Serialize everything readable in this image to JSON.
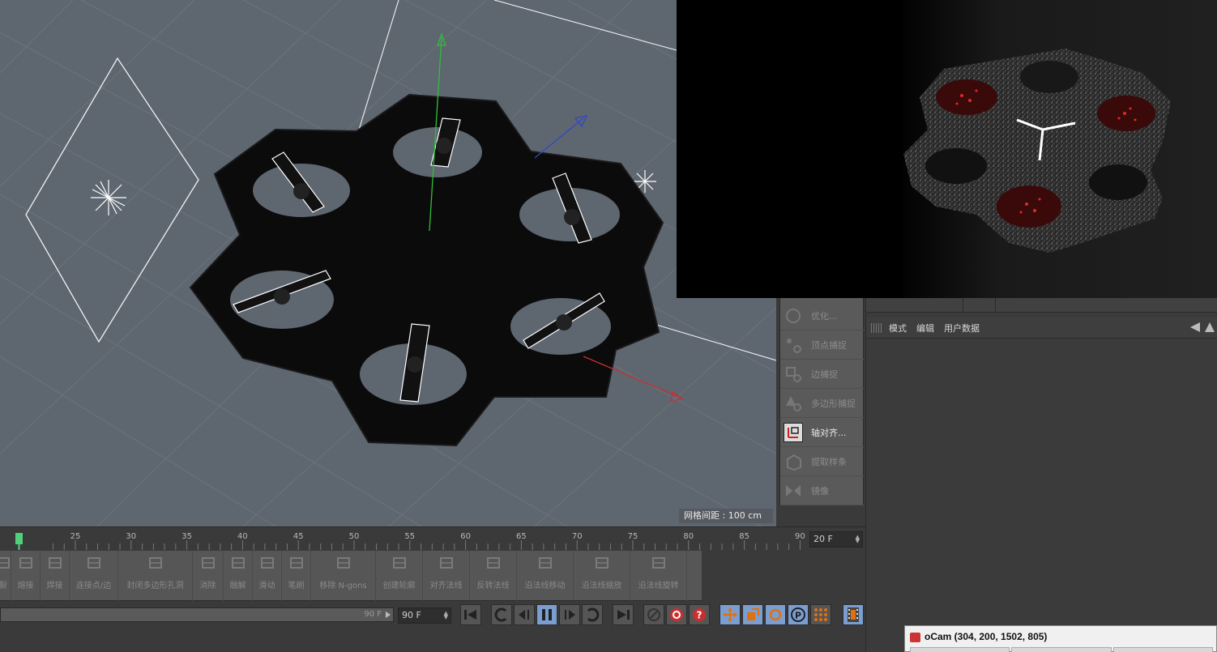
{
  "viewport": {
    "grid_label": "网格间距 : 100 cm"
  },
  "palette": {
    "items": [
      {
        "label": "优化...",
        "icon": "optimize-icon",
        "active": false
      },
      {
        "label": "顶点捕捉",
        "icon": "vertex-snap-icon",
        "active": false
      },
      {
        "label": "边捕捉",
        "icon": "edge-snap-icon",
        "active": false
      },
      {
        "label": "多边形捕捉",
        "icon": "polygon-snap-icon",
        "active": false
      },
      {
        "label": "轴对齐...",
        "icon": "axis-align-icon",
        "active": true
      },
      {
        "label": "提取样条",
        "icon": "extract-spline-icon",
        "active": false
      },
      {
        "label": "镜像",
        "icon": "mirror-icon",
        "active": false
      }
    ]
  },
  "attributes": {
    "menu": [
      "模式",
      "编辑",
      "用户数据"
    ]
  },
  "timeline": {
    "ticks": [
      "25",
      "30",
      "35",
      "40",
      "45",
      "50",
      "55",
      "60",
      "65",
      "70",
      "75",
      "80",
      "85",
      "90"
    ],
    "current_frame": "20 F"
  },
  "mesh_tools": [
    {
      "label": "裂",
      "icon": "split-icon"
    },
    {
      "label": "熔接",
      "icon": "weld-icon"
    },
    {
      "label": "焊接",
      "icon": "stitch-icon"
    },
    {
      "label": "连接点/边",
      "icon": "connect-icon"
    },
    {
      "label": "封闭多边形孔洞",
      "icon": "close-hole-icon"
    },
    {
      "label": "消除",
      "icon": "dissolve-icon"
    },
    {
      "label": "融解",
      "icon": "melt-icon"
    },
    {
      "label": "滑动",
      "icon": "slide-icon"
    },
    {
      "label": "笔刷",
      "icon": "brush-icon"
    },
    {
      "label": "移除 N-gons",
      "icon": "remove-ngons-icon"
    },
    {
      "label": "创建轮廓",
      "icon": "create-outline-icon"
    },
    {
      "label": "对齐法线",
      "icon": "align-normals-icon"
    },
    {
      "label": "反转法线",
      "icon": "reverse-normals-icon"
    },
    {
      "label": "沿法线移动",
      "icon": "normal-move-icon"
    },
    {
      "label": "沿法线缩放",
      "icon": "normal-scale-icon"
    },
    {
      "label": "沿法线旋转",
      "icon": "normal-rotate-icon"
    }
  ],
  "playback": {
    "slider_end": "90 F",
    "max_frame": "90 F"
  },
  "ocam": {
    "title": "oCam (304, 200, 1502, 805)"
  },
  "colors": {
    "viewport_bg": "#5e6670",
    "accent_blue": "#7a9ed0",
    "playhead": "#4fd07a",
    "render_red": "#e02828"
  }
}
